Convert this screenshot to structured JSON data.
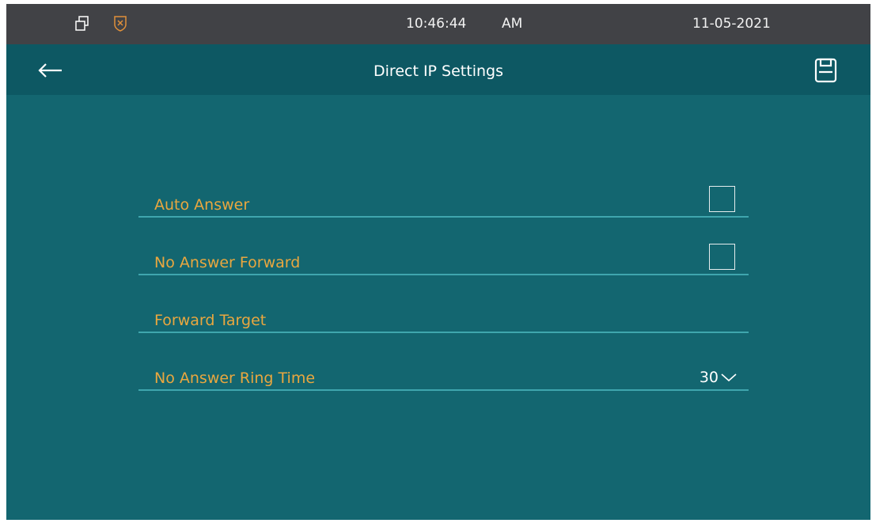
{
  "statusbar": {
    "icons": [
      "window-icon",
      "shield-icon"
    ],
    "time": "10:46:44",
    "ampm": "AM",
    "date": "11-05-2021"
  },
  "header": {
    "title": "Direct IP Settings",
    "back_icon": "back-arrow-icon",
    "save_icon": "save-icon"
  },
  "settings": {
    "rows": [
      {
        "label": "Auto Answer",
        "control": "checkbox",
        "checked": false
      },
      {
        "label": "No Answer Forward",
        "control": "checkbox",
        "checked": false
      },
      {
        "label": "Forward Target",
        "control": "input",
        "value": ""
      },
      {
        "label": "No Answer Ring Time",
        "control": "select",
        "value": "30"
      }
    ]
  },
  "colors": {
    "statusbar_bg": "#414246",
    "titlebar_bg": "#0d5863",
    "screen_bg": "#136670",
    "label": "#e9a73f",
    "divider": "#3fa6ae",
    "shield": "#e0903a"
  }
}
